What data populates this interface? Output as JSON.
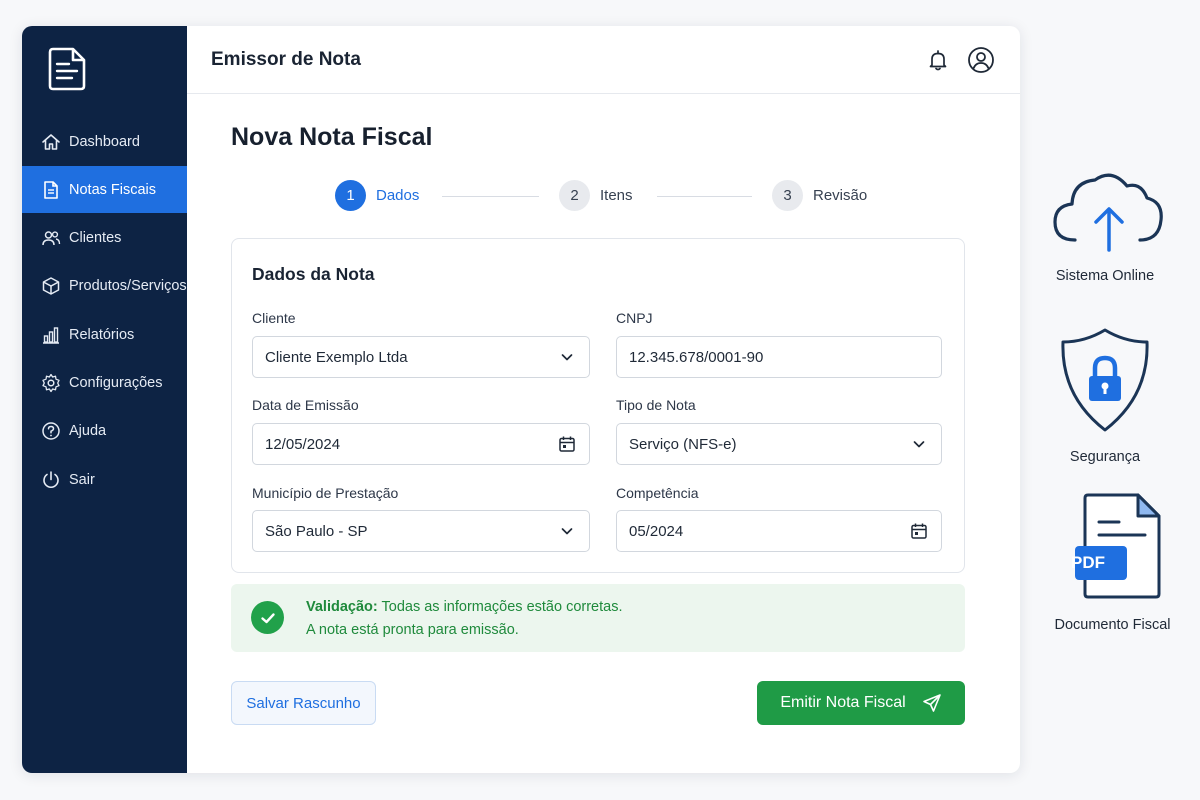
{
  "colors": {
    "sidebar_bg": "#0d2344",
    "accent": "#1f6fe0",
    "success": "#1f9b46",
    "success_bg": "#ecf6ee"
  },
  "sidebar": {
    "logo_icon": "document-icon",
    "items": [
      {
        "label": "Dashboard",
        "icon": "home-icon",
        "active": false
      },
      {
        "label": "Notas Fiscais",
        "icon": "document-icon",
        "active": true
      },
      {
        "label": "Clientes",
        "icon": "users-icon",
        "active": false
      },
      {
        "label": "Produtos/Serviços",
        "icon": "box-icon",
        "active": false
      },
      {
        "label": "Relatórios",
        "icon": "bar-chart-icon",
        "active": false
      },
      {
        "label": "Configurações",
        "icon": "gear-icon",
        "active": false
      },
      {
        "label": "Ajuda",
        "icon": "help-icon",
        "active": false
      },
      {
        "label": "Sair",
        "icon": "power-icon",
        "active": false
      }
    ]
  },
  "header": {
    "title": "Emissor de Nota",
    "icons": [
      "bell-icon",
      "user-icon"
    ]
  },
  "main": {
    "page_title": "Nova Nota Fiscal",
    "steps": [
      {
        "number": "1",
        "label": "Dados",
        "active": true
      },
      {
        "number": "2",
        "label": "Itens",
        "active": false
      },
      {
        "number": "3",
        "label": "Revisão",
        "active": false
      }
    ],
    "card": {
      "title": "Dados da Nota",
      "fields": {
        "cliente": {
          "label": "Cliente",
          "value": "Cliente Exemplo Ltda"
        },
        "cnpj": {
          "label": "CNPJ",
          "value": "12.345.678/0001-90"
        },
        "data_emissao": {
          "label": "Data de Emissão",
          "value": "12/05/2024"
        },
        "tipo_nota": {
          "label": "Tipo de Nota",
          "value": "Serviço (NFS-e)"
        },
        "municipio": {
          "label": "Município de Prestação",
          "value": "São Paulo - SP"
        },
        "competencia": {
          "label": "Competência",
          "value": "05/2024"
        }
      }
    },
    "validation": {
      "title": "Validação:",
      "message": "Todas as informações estão corretas.",
      "message2": "A nota está pronta para emissão."
    },
    "buttons": {
      "save_draft": "Salvar Rascunho",
      "emit": "Emitir Nota Fiscal"
    }
  },
  "features": [
    {
      "label": "Sistema Online",
      "icon": "cloud-upload-icon"
    },
    {
      "label": "Segurança",
      "icon": "shield-lock-icon"
    },
    {
      "label": "Documento Fiscal",
      "icon": "pdf-document-icon",
      "badge": "PDF"
    }
  ]
}
